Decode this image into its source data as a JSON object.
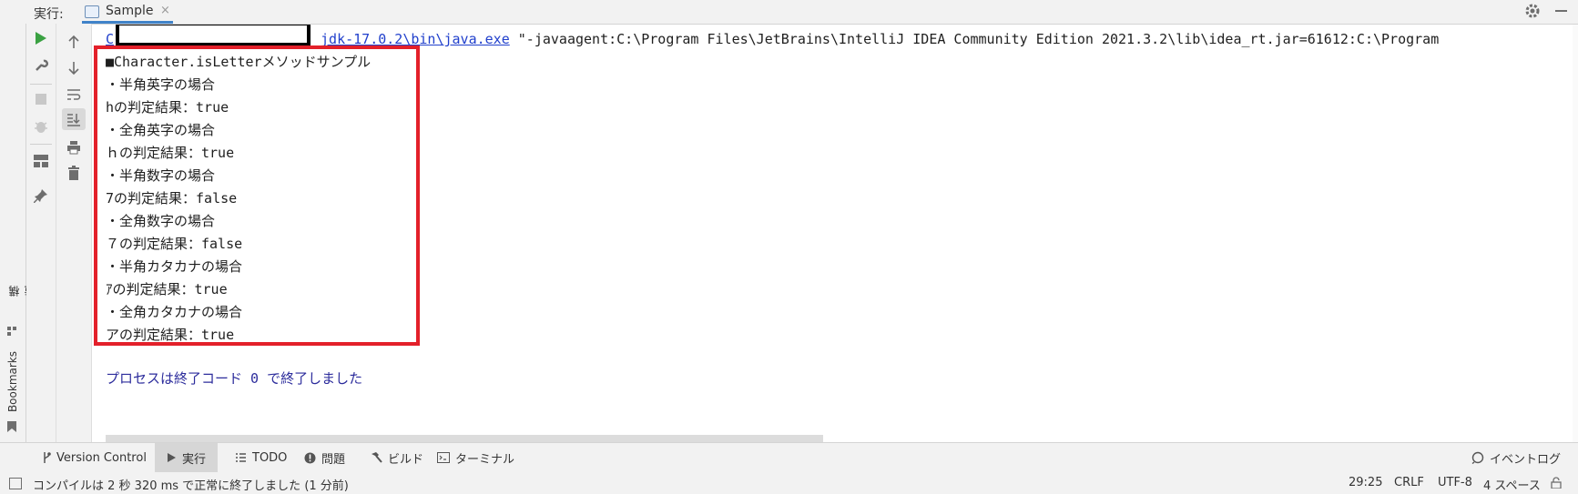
{
  "run_panel": {
    "label": "実行:",
    "tab": {
      "title": "Sample",
      "close": "×"
    }
  },
  "left_stripe": {
    "structure_label": "構造",
    "bookmarks_label": "Bookmarks"
  },
  "console": {
    "command": {
      "prefix": "C",
      "java_path": "jdk-17.0.2\\bin\\java.exe",
      "args": " \"-javaagent:C:\\Program Files\\JetBrains\\IntelliJ IDEA Community Edition 2021.3.2\\lib\\idea_rt.jar=61612:C:\\Program"
    },
    "output_lines": [
      "■Character.isLetterメソッドサンプル",
      "・半角英字の場合",
      "hの判定結果：true",
      "・全角英字の場合",
      "ｈの判定結果：true",
      "・半角数字の場合",
      "7の判定結果：false",
      "・全角数字の場合",
      "７の判定結果：false",
      "・半角カタカナの場合",
      "ｱの判定結果：true",
      "・全角カタカナの場合",
      "アの判定結果：true"
    ],
    "exit_message": "プロセスは終了コード 0 で終了しました"
  },
  "tool_windows": [
    {
      "label": "Version Control",
      "icon": "branch-icon"
    },
    {
      "label": "実行",
      "icon": "run-icon",
      "active": true
    },
    {
      "label": "TODO",
      "icon": "list-icon"
    },
    {
      "label": "問題",
      "icon": "problems-icon"
    },
    {
      "label": "ビルド",
      "icon": "hammer-icon"
    },
    {
      "label": "ターミナル",
      "icon": "terminal-icon"
    }
  ],
  "event_log": {
    "label": "イベントログ"
  },
  "status_bar": {
    "message": "コンパイルは 2 秒 320 ms で正常に終了しました (1 分前)",
    "position": "29:25",
    "line_separator": "CRLF",
    "encoding": "UTF-8",
    "indent": "4 スペース"
  },
  "colors": {
    "highlight_border": "#e3202a",
    "link": "#2140cc",
    "exit_text": "#2c2c9c",
    "run_green": "#3aa142"
  }
}
